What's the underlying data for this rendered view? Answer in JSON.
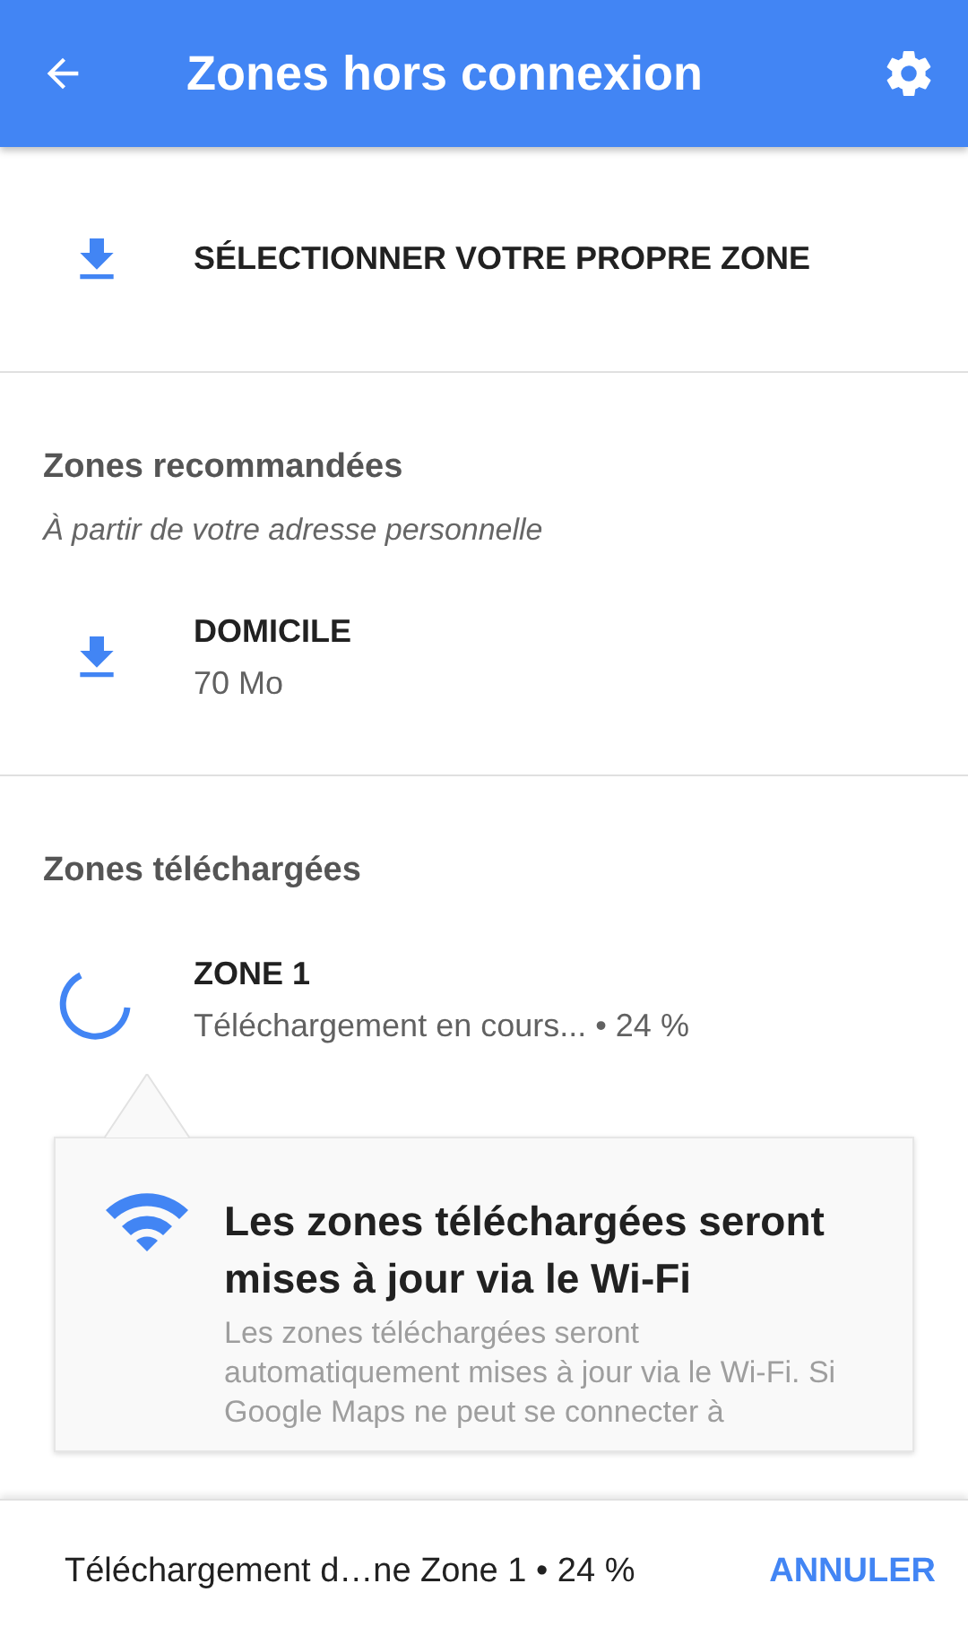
{
  "app_bar": {
    "title": "Zones hors connexion"
  },
  "select_zone": {
    "label": "SÉLECTIONNER VOTRE PROPRE ZONE"
  },
  "recommended": {
    "heading": "Zones recommandées",
    "subtitle": "À partir de votre adresse personnelle",
    "items": [
      {
        "name": "DOMICILE",
        "size": "70 Mo"
      }
    ]
  },
  "downloaded": {
    "heading": "Zones téléchargées",
    "items": [
      {
        "name": "ZONE 1",
        "status": "Téléchargement en cours... • 24 %"
      }
    ]
  },
  "tooltip": {
    "title": "Les zones téléchargées seront mises à jour via le Wi-Fi",
    "body": "Les zones téléchargées seront automatiquement mises à jour via le Wi-Fi. Si Google Maps ne peut se connecter à"
  },
  "bottom_bar": {
    "text": "Téléchargement d…ne Zone 1 • 24 %",
    "action": "ANNULER"
  }
}
